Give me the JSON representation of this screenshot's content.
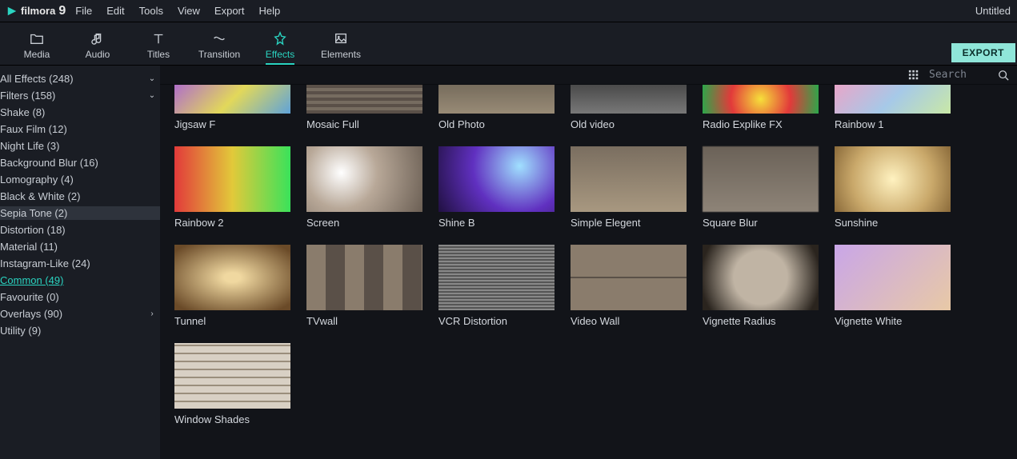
{
  "app": {
    "logo_text": "filmora",
    "logo_num": "9",
    "project_title": "Untitled"
  },
  "menu": [
    "File",
    "Edit",
    "Tools",
    "View",
    "Export",
    "Help"
  ],
  "toolbar": {
    "items": [
      {
        "label": "Media",
        "icon": "folder-icon"
      },
      {
        "label": "Audio",
        "icon": "music-icon"
      },
      {
        "label": "Titles",
        "icon": "text-icon"
      },
      {
        "label": "Transition",
        "icon": "transition-icon"
      },
      {
        "label": "Effects",
        "icon": "effects-icon"
      },
      {
        "label": "Elements",
        "icon": "image-icon"
      }
    ],
    "active_index": 4,
    "export_label": "EXPORT"
  },
  "sidebar": {
    "tree": [
      {
        "label": "All Effects (248)",
        "indent": 0,
        "expand": "down"
      },
      {
        "label": "Filters (158)",
        "indent": 1,
        "expand": "down"
      },
      {
        "label": "Shake (8)",
        "indent": 2
      },
      {
        "label": "Faux Film (12)",
        "indent": 2
      },
      {
        "label": "Night Life (3)",
        "indent": 2
      },
      {
        "label": "Background Blur (16)",
        "indent": 2
      },
      {
        "label": "Lomography (4)",
        "indent": 2
      },
      {
        "label": "Black & White (2)",
        "indent": 2
      },
      {
        "label": "Sepia Tone (2)",
        "indent": 2,
        "selected": true
      },
      {
        "label": "Distortion (18)",
        "indent": 2
      },
      {
        "label": "Material (11)",
        "indent": 2
      },
      {
        "label": "Instagram-Like (24)",
        "indent": 2
      },
      {
        "label": "Common (49)",
        "indent": 2,
        "link": true
      },
      {
        "label": "Favourite (0)",
        "indent": 2
      },
      {
        "label": "Overlays (90)",
        "indent": 1,
        "expand": "right"
      },
      {
        "label": "Utility (9)",
        "indent": 1
      }
    ]
  },
  "search": {
    "placeholder": "Search"
  },
  "effects": [
    {
      "label": "Jigsaw F",
      "g": "g1",
      "row1": true
    },
    {
      "label": "Mosaic Full",
      "g": "g2",
      "row1": true
    },
    {
      "label": "Old Photo",
      "g": "g3",
      "row1": true
    },
    {
      "label": "Old video",
      "g": "g4",
      "row1": true
    },
    {
      "label": "Radio Explike FX",
      "g": "g5",
      "row1": true
    },
    {
      "label": "Rainbow 1",
      "g": "g6",
      "row1": true
    },
    {
      "label": "Rainbow 2",
      "g": "g7"
    },
    {
      "label": "Screen",
      "g": "g8"
    },
    {
      "label": "Shine B",
      "g": "g9"
    },
    {
      "label": "Simple Elegent",
      "g": "g10"
    },
    {
      "label": "Square Blur",
      "g": "g11"
    },
    {
      "label": "Sunshine",
      "g": "g12"
    },
    {
      "label": "Tunnel",
      "g": "g13"
    },
    {
      "label": "TVwall",
      "g": "g14"
    },
    {
      "label": "VCR Distortion",
      "g": "g15"
    },
    {
      "label": "Video Wall",
      "g": "g16"
    },
    {
      "label": "Vignette Radius",
      "g": "g17"
    },
    {
      "label": "Vignette White",
      "g": "g18"
    },
    {
      "label": "Window Shades",
      "g": "g19"
    }
  ]
}
